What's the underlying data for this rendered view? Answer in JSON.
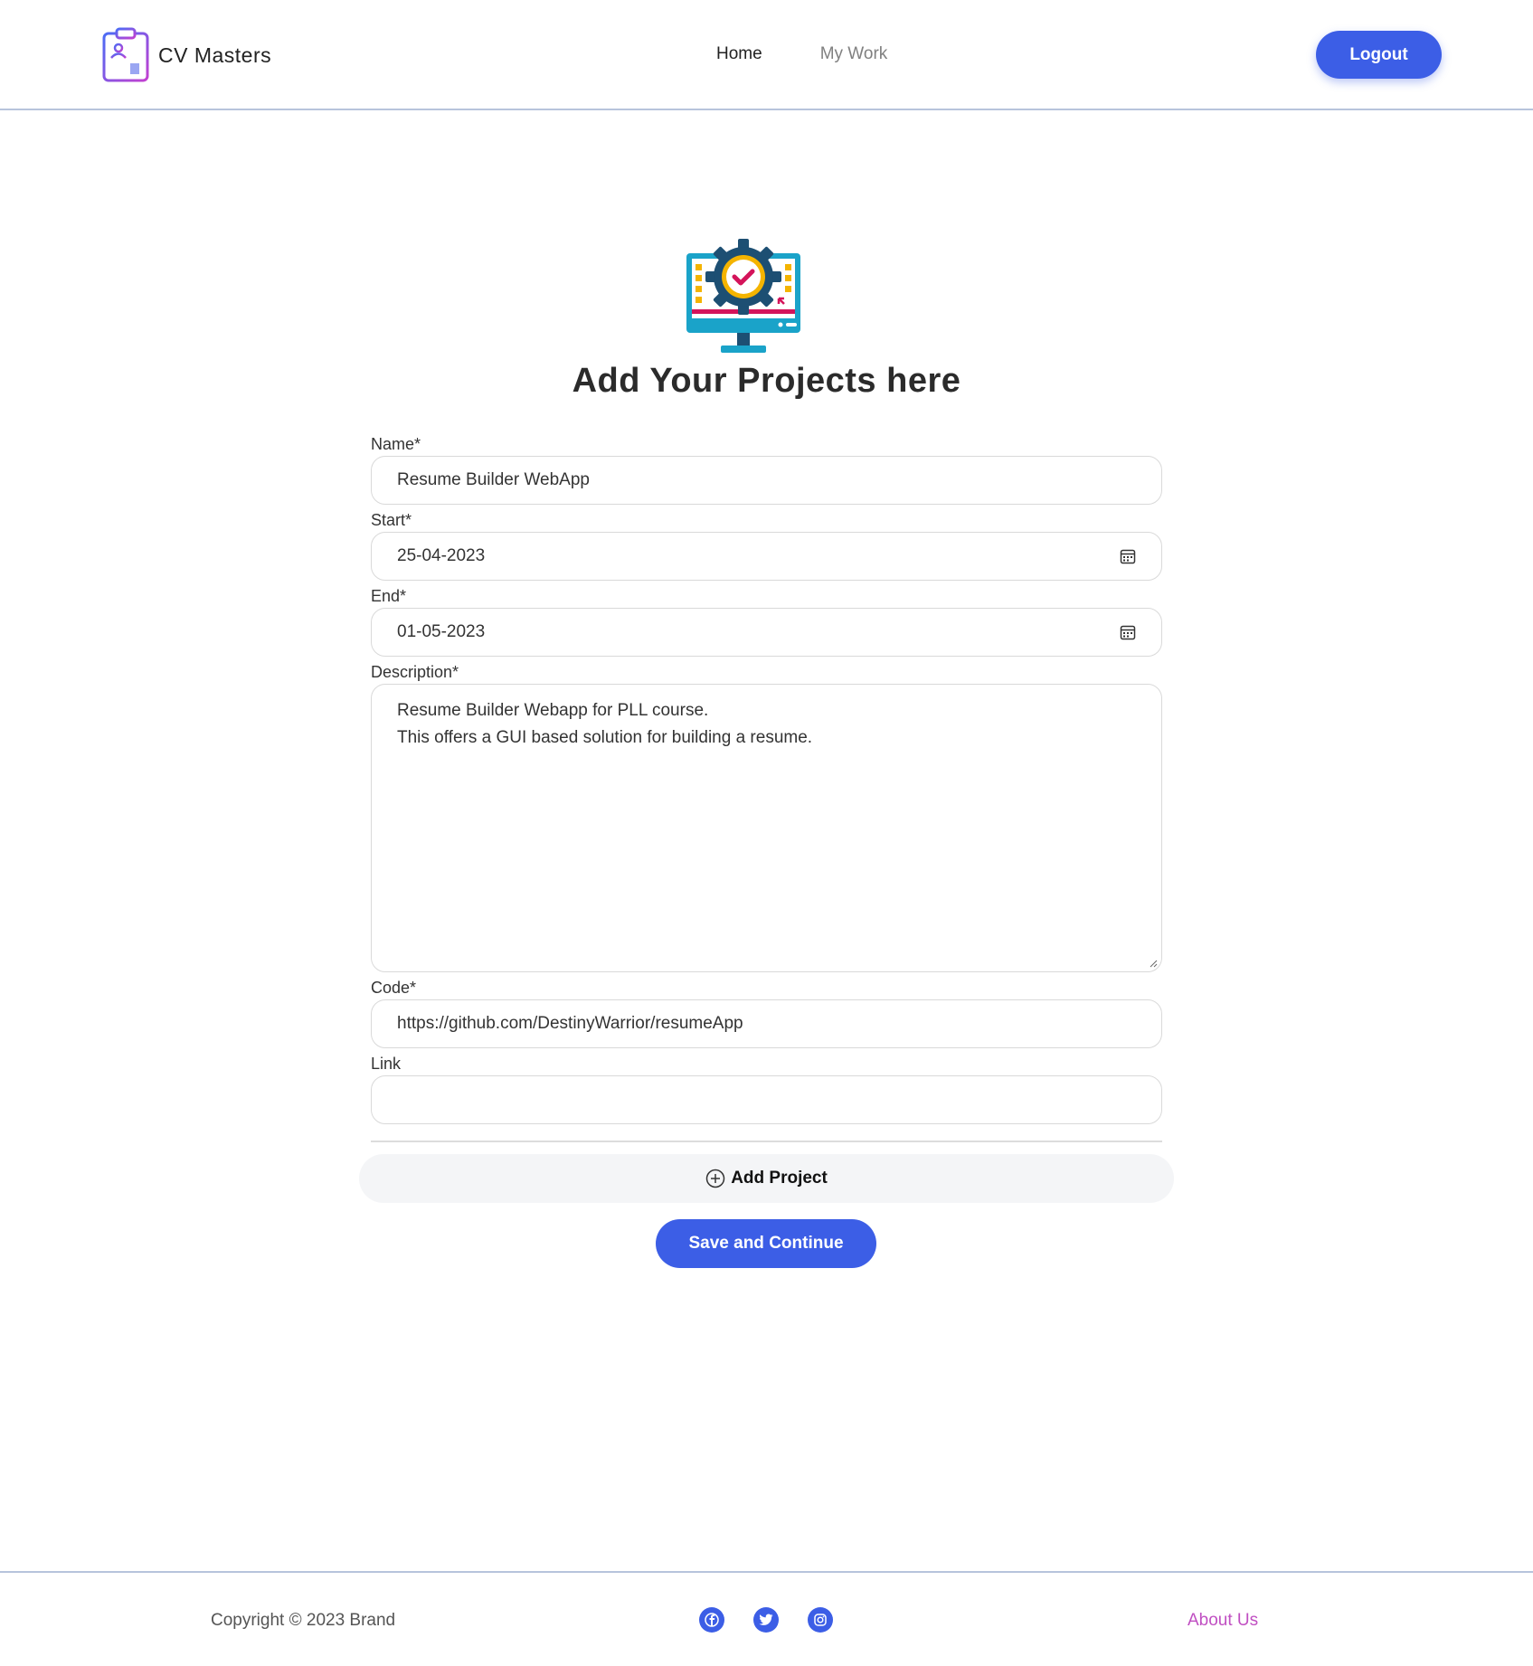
{
  "header": {
    "brand_name": "CV Masters",
    "nav": {
      "home": "Home",
      "my_work": "My Work"
    },
    "logout_label": "Logout"
  },
  "main": {
    "title": "Add Your Projects here",
    "fields": {
      "name": {
        "label": "Name*",
        "value": "Resume Builder WebApp"
      },
      "start": {
        "label": "Start*",
        "value": "25-04-2023"
      },
      "end": {
        "label": "End*",
        "value": "01-05-2023"
      },
      "description": {
        "label": "Description*",
        "line1": "Resume Builder Webapp for PLL course.",
        "line2": "This offers a GUI based solution for building a resume."
      },
      "code": {
        "label": "Code*",
        "value": "https://github.com/DestinyWarrior/resumeApp"
      },
      "link": {
        "label": "Link",
        "value": ""
      }
    },
    "add_project_label": "Add Project",
    "save_label": "Save and Continue"
  },
  "footer": {
    "copyright": "Copyright © 2023 Brand",
    "socials": [
      "facebook-icon",
      "twitter-icon",
      "instagram-icon"
    ],
    "about_label": "About Us"
  },
  "colors": {
    "primary": "#3c5ee6",
    "about_link": "#c04fc2"
  }
}
